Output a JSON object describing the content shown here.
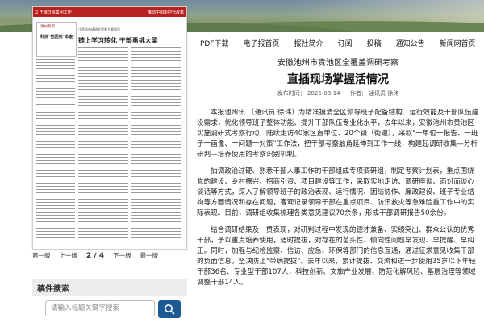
{
  "nav": {
    "items": [
      "PDF下载",
      "电子报首页",
      "报社简介",
      "订阅",
      "投稿",
      "通知公告",
      "新闻网首页"
    ]
  },
  "paper": {
    "masthead_left": "2 于潭日报集团工作",
    "masthead_right": "推动中国新时代改革",
    "box_tag": "池州新风",
    "box_headline": "科抚\"他回到\"本金\"",
    "sub": "江西省市场研究党委主要领导",
    "headline": "链上学习转化  干部勇挑大梁"
  },
  "pager": {
    "first": "第一版",
    "prev": "上一版",
    "current": "2 / 4",
    "next": "下一版",
    "last": "最一版"
  },
  "search": {
    "heading": "稿件搜索",
    "placeholder": "请输入标题关键字搜索"
  },
  "article": {
    "kicker": "安徽池州市贵池区全覆盖调研考察",
    "title": "直插现场掌握活情况",
    "date": "发布时间： 2025-08-14",
    "author": "作者： 通讯员 徐玮",
    "paragraphs": [
      "本报池州讯 （通讯员 徐玮）为精准摸清全区领导班子配备结构、运行效能及干部队伍建设需求，优化领导班子整体功能、提升干部队伍专业化水平，去年以来，安徽池州市贵池区实施调研式考察行动，陆续走访40家区直单位、20个镇（街道），采取\"一单位一报告、一班子一画像、一问题一对策\"工作法，把干部考察触角延伸到工作一线，构建起调研收集—分析研判—培养使用的考察识别机制。",
      "抽调政治过硬、熟悉干部人事工作的干部组成专项调研组，制定考察计划表，重点围绕党的建设、乡村振兴、招商引资、项目建设等工作，采取实地走访、调研座谈、面对面谈心谈话等方式，深入了解领导班子的政治表现、运行情况、团结协作、廉政建设、班子专业结构等方面情况和存在问题，客观记录领导干部在重点项目、防汛救灾等急难险重工作中的实际表现。目前，调研组收集梳理各类意见建议70余条，形成干部调研报告50余份。",
      "结合调研结果及一贯表现，对研判过程中发现的德才兼备、实绩突出、群众公认的优秀干部，予以重点培养使用，适时提拔，对存在的苗头性、倾向性问题早发现、早提醒、早纠正。同时，加强与纪检监察、信访、应急、环保等部门的信息互通，通过征求意见收集干部的负面信息，坚决防止\"带病提拔\"。去年以来，累计提拔、交流和进一步使用35岁以下年轻干部36名、专业型干部107人，科技创新、文旅产业发展、防范化解风险、基层治理等领域调整干部14人。"
    ]
  }
}
